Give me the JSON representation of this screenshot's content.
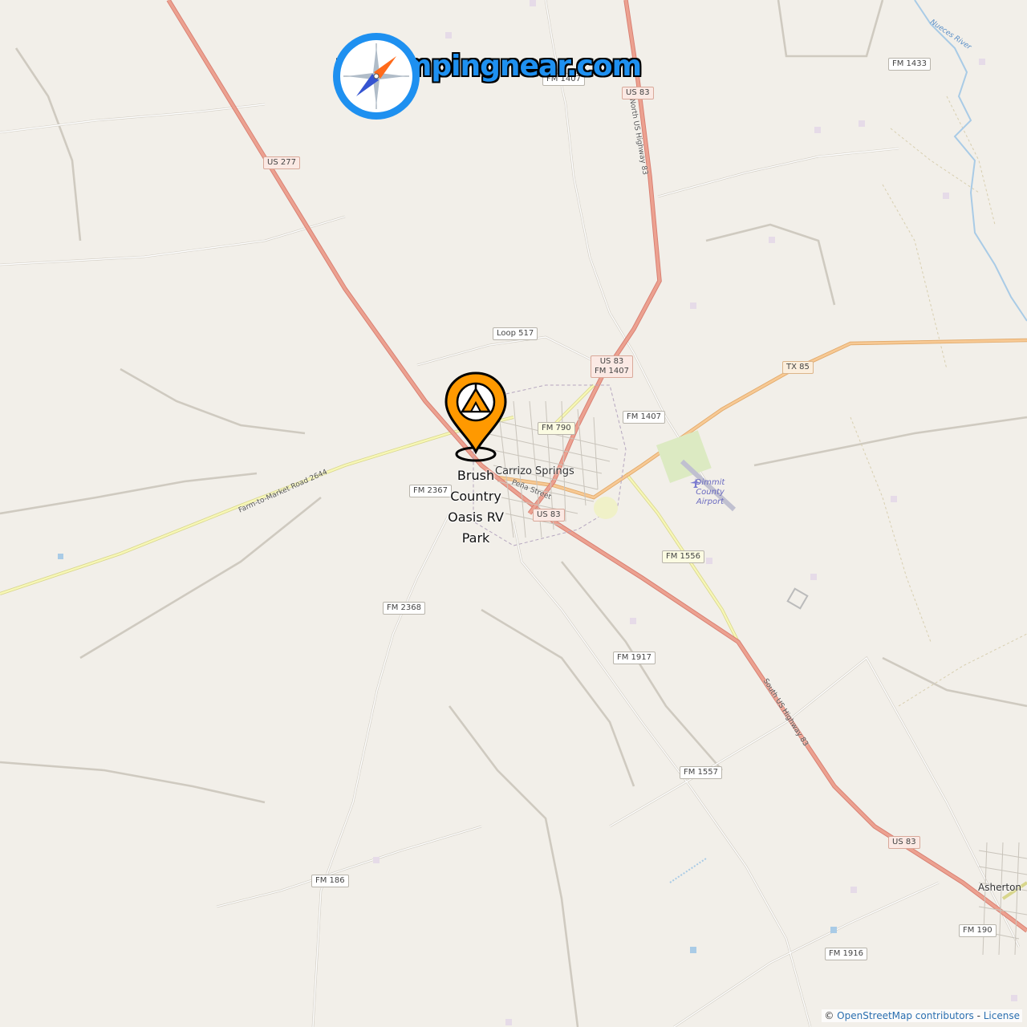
{
  "brand": {
    "name": "rvcampingnear.com",
    "icon": "compass-icon"
  },
  "marker": {
    "icon": "tent-pin-icon",
    "label_lines": [
      "Brush",
      "Country",
      "Oasis RV",
      "Park"
    ],
    "color": "#ff9900"
  },
  "places": {
    "carrizo_springs": "Carrizo Springs",
    "asherton": "Asherton"
  },
  "airport": {
    "lines": [
      "Dimmit",
      "County",
      "Airport"
    ],
    "icon": "airport-icon"
  },
  "shields": {
    "us277": "US 277",
    "us83_north": "US 83",
    "us83_junction": "US 83",
    "fm1407_junction": "FM 1407",
    "fm1407": "FM 1407",
    "fm1407_top": "FM 1407",
    "fm1433": "FM 1433",
    "loop517": "Loop 517",
    "fm790": "FM 790",
    "tx85": "TX 85",
    "fm2367": "FM 2367",
    "us83_center": "US 83",
    "fm1556": "FM 1556",
    "fm2368": "FM 2368",
    "fm1917": "FM 1917",
    "fm1557": "FM 1557",
    "us83_south": "US 83",
    "fm186": "FM 186",
    "fm190": "FM 190",
    "fm1916": "FM 1916"
  },
  "road_names": {
    "farm_to_market_2644": "Farm-to-Market Road 2644",
    "north_us_83": "North US Highway 83",
    "south_us_83": "South US Highway 83",
    "pena_street": "Peña Street"
  },
  "river": {
    "name": "Nueces River"
  },
  "attribution": {
    "prefix": "© ",
    "osm": "OpenStreetMap contributors",
    "separator": " - ",
    "license": "License"
  },
  "colors": {
    "land": "#f2efe9",
    "primary_road": "#e8968a",
    "secondary_road": "#f3c18d",
    "tertiary_road": "#ecef9f",
    "minor_road": "#ffffff",
    "water": "#a9cbe6",
    "brand_blue": "#1e90f0"
  }
}
